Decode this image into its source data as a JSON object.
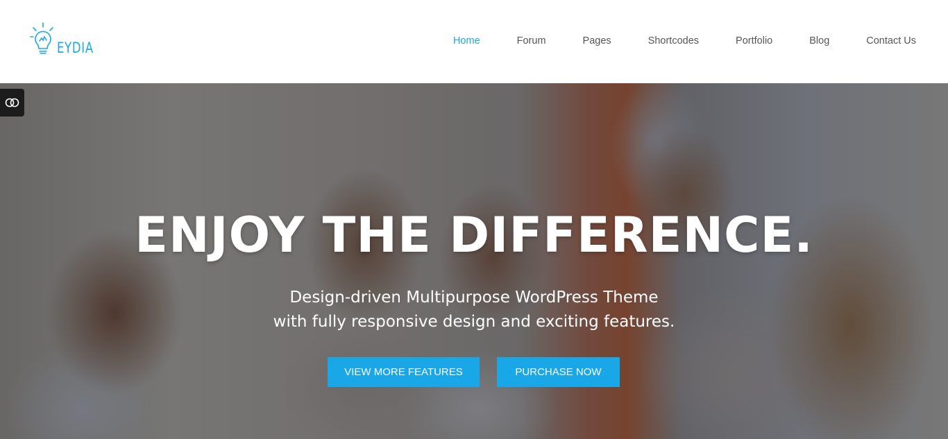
{
  "brand": {
    "logo_text": "EYDIA",
    "accent_color": "#1aa7e8"
  },
  "nav": {
    "items": [
      {
        "label": "Home",
        "active": true
      },
      {
        "label": "Forum",
        "active": false
      },
      {
        "label": "Pages",
        "active": false
      },
      {
        "label": "Shortcodes",
        "active": false
      },
      {
        "label": "Portfolio",
        "active": false
      },
      {
        "label": "Blog",
        "active": false
      },
      {
        "label": "Contact Us",
        "active": false
      }
    ]
  },
  "hero": {
    "title": "ENJOY THE DIFFERENCE.",
    "subtitle_line1": "Design-driven Multipurpose WordPress Theme",
    "subtitle_line2": "with fully responsive design and exciting features.",
    "buttons": {
      "features_label": "VIEW MORE FEATURES",
      "purchase_label": "PURCHASE NOW"
    },
    "side_toggle_icon": "toggle-icon"
  }
}
